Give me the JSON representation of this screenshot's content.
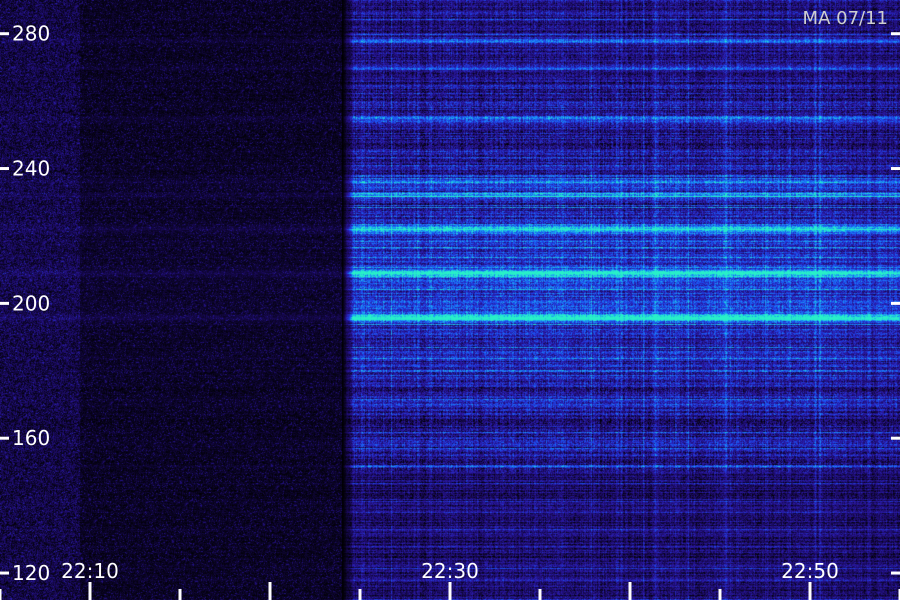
{
  "chart_data": {
    "type": "heatmap",
    "title": "",
    "xlabel": "",
    "ylabel": "",
    "stamp": "MA 07/11",
    "x_ticks": [
      "22:10",
      "22:30",
      "22:50"
    ],
    "y_ticks": [
      280,
      240,
      200,
      160,
      120
    ],
    "xlim": [
      "22:05",
      "22:55"
    ],
    "ylim": [
      112,
      290
    ],
    "signal_onset": "22:24",
    "bright_bands": [
      {
        "freq": 209,
        "intensity": 0.95
      },
      {
        "freq": 196,
        "intensity": 0.9
      },
      {
        "freq": 222,
        "intensity": 0.85
      },
      {
        "freq": 236,
        "intensity": 0.6
      },
      {
        "freq": 232,
        "intensity": 0.55
      },
      {
        "freq": 278,
        "intensity": 0.5
      },
      {
        "freq": 255,
        "intensity": 0.45
      },
      {
        "freq": 270,
        "intensity": 0.4
      }
    ],
    "colormap": [
      "#000000",
      "#1a0a5e",
      "#2a1aa8",
      "#1c4cf0",
      "#1a9cf4",
      "#28f0c8"
    ],
    "grid": false
  }
}
